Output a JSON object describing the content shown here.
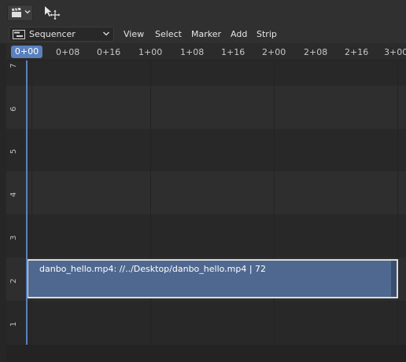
{
  "toolbar": {
    "editor_type_icon": "clapperboard-icon",
    "tool_icon": "move-cursor-icon"
  },
  "header": {
    "mode_icon": "sequencer-icon",
    "mode": "Sequencer",
    "menus": [
      "View",
      "Select",
      "Marker",
      "Add",
      "Strip"
    ]
  },
  "ruler": {
    "current_frame": "0+00",
    "ticks": [
      "0+08",
      "0+16",
      "1+00",
      "1+08",
      "1+16",
      "2+00",
      "2+08",
      "2+16",
      "3+00"
    ]
  },
  "channels": [
    "7",
    "6",
    "5",
    "4",
    "3",
    "2",
    "1"
  ],
  "strip": {
    "label": "danbo_hello.mp4: //../Desktop/danbo_hello.mp4 | 72",
    "color": "#4f6890"
  },
  "colors": {
    "accent": "#5a80bd"
  }
}
